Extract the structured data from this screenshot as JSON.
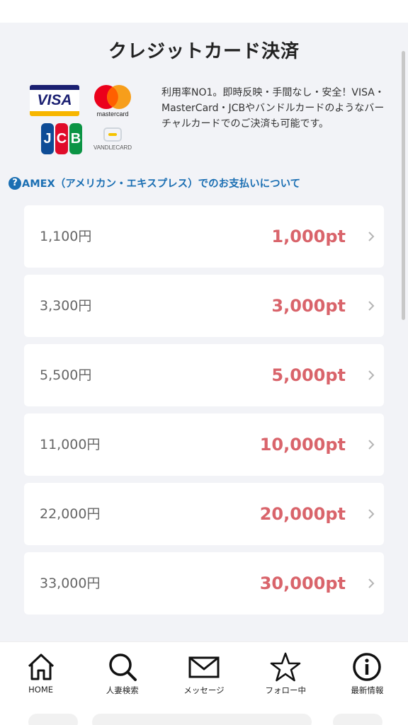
{
  "page": {
    "title": "クレジットカード決済",
    "description": "利用率NO1。即時反映・手間なし・安全！VISA・MasterCard・JCBやバンドルカードのようなバーチャルカードでのご決済も可能です。",
    "amex_link": "AMEX（アメリカン・エキスプレス）でのお支払いについて"
  },
  "logos": {
    "visa": "VISA",
    "mastercard": "mastercard",
    "jcb": [
      "J",
      "C",
      "B"
    ],
    "vandle": "VANDLECARD"
  },
  "plans": [
    {
      "price": "1,100円",
      "points": "1,000pt"
    },
    {
      "price": "3,300円",
      "points": "3,000pt"
    },
    {
      "price": "5,500円",
      "points": "5,000pt"
    },
    {
      "price": "11,000円",
      "points": "10,000pt"
    },
    {
      "price": "22,000円",
      "points": "20,000pt"
    },
    {
      "price": "33,000円",
      "points": "30,000pt"
    }
  ],
  "nav": [
    {
      "label": "HOME",
      "icon": "home-icon"
    },
    {
      "label": "人妻検索",
      "icon": "search-icon"
    },
    {
      "label": "メッセージ",
      "icon": "mail-icon"
    },
    {
      "label": "フォロー中",
      "icon": "star-icon"
    },
    {
      "label": "最新情報",
      "icon": "info-icon"
    }
  ],
  "colors": {
    "points": "#d9646b",
    "link": "#1b6fb3",
    "background": "#f2f3f7"
  }
}
